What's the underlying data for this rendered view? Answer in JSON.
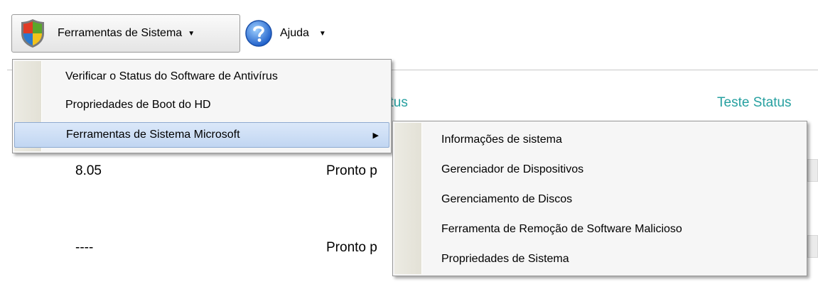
{
  "toolbar": {
    "system_tools": {
      "label": "Ferramentas de Sistema",
      "icon": "windows-shield-icon",
      "arrow": "▼"
    },
    "help": {
      "label": "Ajuda",
      "icon": "help-question-icon",
      "arrow": "▼"
    }
  },
  "table": {
    "headers": {
      "status": "Status",
      "test_status": "Teste Status"
    },
    "rows": [
      {
        "version": "8.05",
        "status": "Pronto p"
      },
      {
        "version": "----",
        "status": "Pronto p"
      }
    ]
  },
  "menu": {
    "items": [
      {
        "label": "Verificar o Status do Software de Antivírus"
      },
      {
        "label": "Propriedades de Boot do HD"
      },
      {
        "label": "Ferramentas de Sistema Microsoft",
        "arrow": "▶"
      }
    ]
  },
  "submenu": {
    "items": [
      {
        "label": "Informações de sistema"
      },
      {
        "label": "Gerenciador de Dispositivos"
      },
      {
        "label": "Gerenciamento de Discos"
      },
      {
        "label": "Ferramenta de Remoção de Software Malicioso"
      },
      {
        "label": "Propriedades de Sistema"
      }
    ]
  },
  "colors": {
    "accent_header": "#26a0a0",
    "menu_highlight": "#c1d6f2"
  }
}
